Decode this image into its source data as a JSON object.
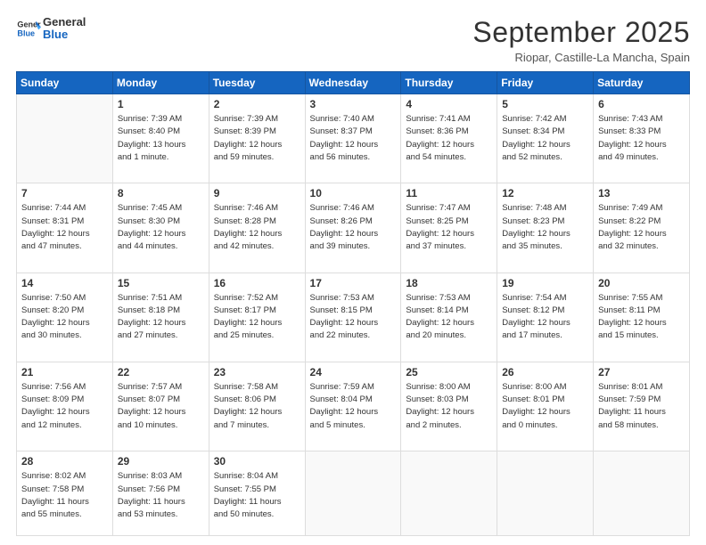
{
  "header": {
    "logo_line1": "General",
    "logo_line2": "Blue",
    "month": "September 2025",
    "location": "Riopar, Castille-La Mancha, Spain"
  },
  "weekdays": [
    "Sunday",
    "Monday",
    "Tuesday",
    "Wednesday",
    "Thursday",
    "Friday",
    "Saturday"
  ],
  "weeks": [
    [
      {
        "day": "",
        "info": ""
      },
      {
        "day": "1",
        "info": "Sunrise: 7:39 AM\nSunset: 8:40 PM\nDaylight: 13 hours\nand 1 minute."
      },
      {
        "day": "2",
        "info": "Sunrise: 7:39 AM\nSunset: 8:39 PM\nDaylight: 12 hours\nand 59 minutes."
      },
      {
        "day": "3",
        "info": "Sunrise: 7:40 AM\nSunset: 8:37 PM\nDaylight: 12 hours\nand 56 minutes."
      },
      {
        "day": "4",
        "info": "Sunrise: 7:41 AM\nSunset: 8:36 PM\nDaylight: 12 hours\nand 54 minutes."
      },
      {
        "day": "5",
        "info": "Sunrise: 7:42 AM\nSunset: 8:34 PM\nDaylight: 12 hours\nand 52 minutes."
      },
      {
        "day": "6",
        "info": "Sunrise: 7:43 AM\nSunset: 8:33 PM\nDaylight: 12 hours\nand 49 minutes."
      }
    ],
    [
      {
        "day": "7",
        "info": "Sunrise: 7:44 AM\nSunset: 8:31 PM\nDaylight: 12 hours\nand 47 minutes."
      },
      {
        "day": "8",
        "info": "Sunrise: 7:45 AM\nSunset: 8:30 PM\nDaylight: 12 hours\nand 44 minutes."
      },
      {
        "day": "9",
        "info": "Sunrise: 7:46 AM\nSunset: 8:28 PM\nDaylight: 12 hours\nand 42 minutes."
      },
      {
        "day": "10",
        "info": "Sunrise: 7:46 AM\nSunset: 8:26 PM\nDaylight: 12 hours\nand 39 minutes."
      },
      {
        "day": "11",
        "info": "Sunrise: 7:47 AM\nSunset: 8:25 PM\nDaylight: 12 hours\nand 37 minutes."
      },
      {
        "day": "12",
        "info": "Sunrise: 7:48 AM\nSunset: 8:23 PM\nDaylight: 12 hours\nand 35 minutes."
      },
      {
        "day": "13",
        "info": "Sunrise: 7:49 AM\nSunset: 8:22 PM\nDaylight: 12 hours\nand 32 minutes."
      }
    ],
    [
      {
        "day": "14",
        "info": "Sunrise: 7:50 AM\nSunset: 8:20 PM\nDaylight: 12 hours\nand 30 minutes."
      },
      {
        "day": "15",
        "info": "Sunrise: 7:51 AM\nSunset: 8:18 PM\nDaylight: 12 hours\nand 27 minutes."
      },
      {
        "day": "16",
        "info": "Sunrise: 7:52 AM\nSunset: 8:17 PM\nDaylight: 12 hours\nand 25 minutes."
      },
      {
        "day": "17",
        "info": "Sunrise: 7:53 AM\nSunset: 8:15 PM\nDaylight: 12 hours\nand 22 minutes."
      },
      {
        "day": "18",
        "info": "Sunrise: 7:53 AM\nSunset: 8:14 PM\nDaylight: 12 hours\nand 20 minutes."
      },
      {
        "day": "19",
        "info": "Sunrise: 7:54 AM\nSunset: 8:12 PM\nDaylight: 12 hours\nand 17 minutes."
      },
      {
        "day": "20",
        "info": "Sunrise: 7:55 AM\nSunset: 8:11 PM\nDaylight: 12 hours\nand 15 minutes."
      }
    ],
    [
      {
        "day": "21",
        "info": "Sunrise: 7:56 AM\nSunset: 8:09 PM\nDaylight: 12 hours\nand 12 minutes."
      },
      {
        "day": "22",
        "info": "Sunrise: 7:57 AM\nSunset: 8:07 PM\nDaylight: 12 hours\nand 10 minutes."
      },
      {
        "day": "23",
        "info": "Sunrise: 7:58 AM\nSunset: 8:06 PM\nDaylight: 12 hours\nand 7 minutes."
      },
      {
        "day": "24",
        "info": "Sunrise: 7:59 AM\nSunset: 8:04 PM\nDaylight: 12 hours\nand 5 minutes."
      },
      {
        "day": "25",
        "info": "Sunrise: 8:00 AM\nSunset: 8:03 PM\nDaylight: 12 hours\nand 2 minutes."
      },
      {
        "day": "26",
        "info": "Sunrise: 8:00 AM\nSunset: 8:01 PM\nDaylight: 12 hours\nand 0 minutes."
      },
      {
        "day": "27",
        "info": "Sunrise: 8:01 AM\nSunset: 7:59 PM\nDaylight: 11 hours\nand 58 minutes."
      }
    ],
    [
      {
        "day": "28",
        "info": "Sunrise: 8:02 AM\nSunset: 7:58 PM\nDaylight: 11 hours\nand 55 minutes."
      },
      {
        "day": "29",
        "info": "Sunrise: 8:03 AM\nSunset: 7:56 PM\nDaylight: 11 hours\nand 53 minutes."
      },
      {
        "day": "30",
        "info": "Sunrise: 8:04 AM\nSunset: 7:55 PM\nDaylight: 11 hours\nand 50 minutes."
      },
      {
        "day": "",
        "info": ""
      },
      {
        "day": "",
        "info": ""
      },
      {
        "day": "",
        "info": ""
      },
      {
        "day": "",
        "info": ""
      }
    ]
  ]
}
